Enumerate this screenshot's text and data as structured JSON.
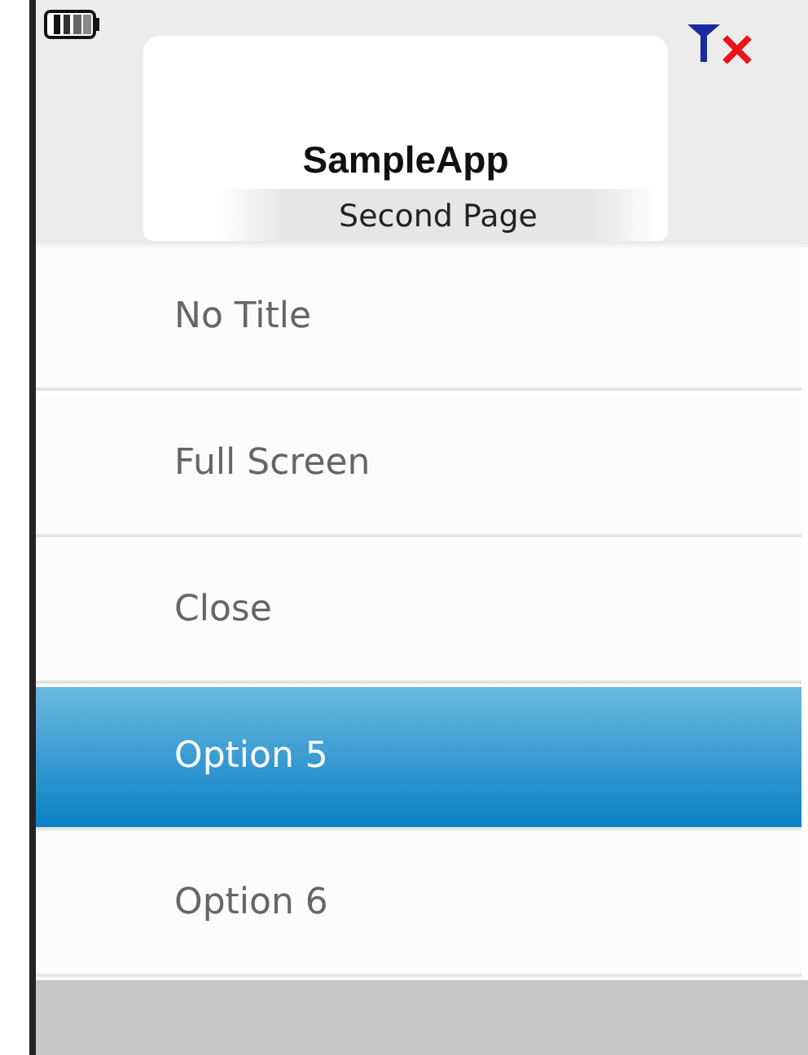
{
  "header": {
    "title": "SampleApp",
    "subtitle": "Second Page"
  },
  "menu": [
    {
      "label": "No Title",
      "selected": false
    },
    {
      "label": "Full Screen",
      "selected": false
    },
    {
      "label": "Close",
      "selected": false
    },
    {
      "label": "Option 5",
      "selected": true
    },
    {
      "label": "Option 6",
      "selected": false
    }
  ]
}
